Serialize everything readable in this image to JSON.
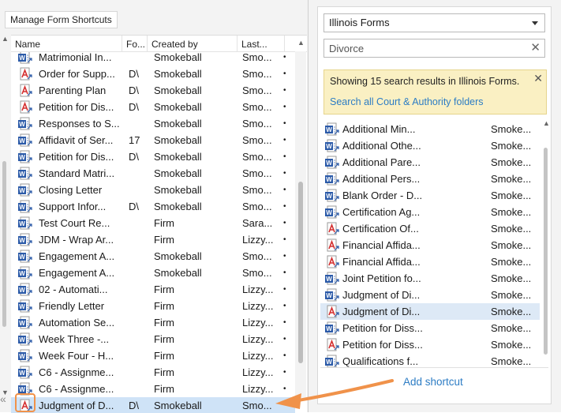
{
  "left": {
    "manage_button": "Manage Form Shortcuts",
    "columns": {
      "name": "Name",
      "fo": "Fo...",
      "created_by": "Created by",
      "last": "Last..."
    },
    "rows": [
      {
        "icon": "word",
        "name": "Matrimonial In...",
        "fo": "",
        "created_by": "Smokeball",
        "last": "Smo...",
        "x": "•"
      },
      {
        "icon": "pdf",
        "name": "Order for Supp...",
        "fo": "D\\",
        "created_by": "Smokeball",
        "last": "Smo...",
        "x": "•"
      },
      {
        "icon": "pdf",
        "name": "Parenting Plan",
        "fo": "D\\",
        "created_by": "Smokeball",
        "last": "Smo...",
        "x": "•"
      },
      {
        "icon": "pdf",
        "name": "Petition for Dis...",
        "fo": "D\\",
        "created_by": "Smokeball",
        "last": "Smo...",
        "x": "•"
      },
      {
        "icon": "word",
        "name": "Responses to S...",
        "fo": "",
        "created_by": "Smokeball",
        "last": "Smo...",
        "x": "•"
      },
      {
        "icon": "word",
        "name": "Affidavit of Ser...",
        "fo": "17",
        "created_by": "Smokeball",
        "last": "Smo...",
        "x": "•"
      },
      {
        "icon": "word",
        "name": "Petition for Dis...",
        "fo": "D\\",
        "created_by": "Smokeball",
        "last": "Smo...",
        "x": "•"
      },
      {
        "icon": "word",
        "name": "Standard Matri...",
        "fo": "",
        "created_by": "Smokeball",
        "last": "Smo...",
        "x": "•"
      },
      {
        "icon": "word",
        "name": "Closing Letter",
        "fo": "",
        "created_by": "Smokeball",
        "last": "Smo...",
        "x": "•"
      },
      {
        "icon": "word",
        "name": "Support Infor...",
        "fo": "D\\",
        "created_by": "Smokeball",
        "last": "Smo...",
        "x": "•"
      },
      {
        "icon": "word",
        "name": "Test Court Re...",
        "fo": "",
        "created_by": "Firm",
        "last": "Sara...",
        "x": "•"
      },
      {
        "icon": "word",
        "name": "JDM - Wrap Ar...",
        "fo": "",
        "created_by": "Firm",
        "last": "Lizzy...",
        "x": "•"
      },
      {
        "icon": "word",
        "name": "Engagement A...",
        "fo": "",
        "created_by": "Smokeball",
        "last": "Smo...",
        "x": "•"
      },
      {
        "icon": "word",
        "name": "Engagement A...",
        "fo": "",
        "created_by": "Smokeball",
        "last": "Smo...",
        "x": "•"
      },
      {
        "icon": "word",
        "name": "02 - Automati...",
        "fo": "",
        "created_by": "Firm",
        "last": "Lizzy...",
        "x": "•"
      },
      {
        "icon": "word",
        "name": "Friendly Letter",
        "fo": "",
        "created_by": "Firm",
        "last": "Lizzy...",
        "x": "•"
      },
      {
        "icon": "word",
        "name": "Automation Se...",
        "fo": "",
        "created_by": "Firm",
        "last": "Lizzy...",
        "x": "•"
      },
      {
        "icon": "word",
        "name": "Week Three -...",
        "fo": "",
        "created_by": "Firm",
        "last": "Lizzy...",
        "x": "•"
      },
      {
        "icon": "word",
        "name": "Week Four - H...",
        "fo": "",
        "created_by": "Firm",
        "last": "Lizzy...",
        "x": "•"
      },
      {
        "icon": "word",
        "name": "C6 - Assignme...",
        "fo": "",
        "created_by": "Firm",
        "last": "Lizzy...",
        "x": "•"
      },
      {
        "icon": "word",
        "name": "C6 - Assignme...",
        "fo": "",
        "created_by": "Firm",
        "last": "Lizzy...",
        "x": "•"
      },
      {
        "icon": "pdf",
        "name": "Judgment of D...",
        "fo": "D\\",
        "created_by": "Smokeball",
        "last": "Smo...",
        "x": "",
        "selected": true
      }
    ],
    "collapse": "«"
  },
  "right": {
    "dropdown": "Illinois Forms",
    "search_value": "Divorce",
    "notice": {
      "text": "Showing 15 search results in Illinois Forms.",
      "link": "Search all Court & Authority folders"
    },
    "results": [
      {
        "icon": "word",
        "name": "Additional Min...",
        "last": "Smoke..."
      },
      {
        "icon": "word",
        "name": "Additional Othe...",
        "last": "Smoke..."
      },
      {
        "icon": "word",
        "name": "Additional Pare...",
        "last": "Smoke..."
      },
      {
        "icon": "word",
        "name": "Additional Pers...",
        "last": "Smoke..."
      },
      {
        "icon": "word",
        "name": "Blank Order - D...",
        "last": "Smoke..."
      },
      {
        "icon": "word",
        "name": "Certification Ag...",
        "last": "Smoke..."
      },
      {
        "icon": "pdf",
        "name": "Certification Of...",
        "last": "Smoke..."
      },
      {
        "icon": "pdf",
        "name": "Financial Affida...",
        "last": "Smoke..."
      },
      {
        "icon": "pdf",
        "name": "Financial Affida...",
        "last": "Smoke..."
      },
      {
        "icon": "word",
        "name": "Joint Petition fo...",
        "last": "Smoke..."
      },
      {
        "icon": "word",
        "name": "Judgment of Di...",
        "last": "Smoke..."
      },
      {
        "icon": "pdf",
        "name": "Judgment of Di...",
        "last": "Smoke...",
        "selected": true
      },
      {
        "icon": "word",
        "name": "Petition for Diss...",
        "last": "Smoke..."
      },
      {
        "icon": "pdf",
        "name": "Petition for Diss...",
        "last": "Smoke..."
      },
      {
        "icon": "word",
        "name": "Qualifications f...",
        "last": "Smoke..."
      }
    ],
    "add_shortcut": "Add shortcut"
  },
  "colors": {
    "word": "#2b5aa8",
    "pdf": "#d42f2f",
    "link": "#2c7cc4",
    "selection": "#cfe3f7",
    "arrow": "#f0924a"
  }
}
